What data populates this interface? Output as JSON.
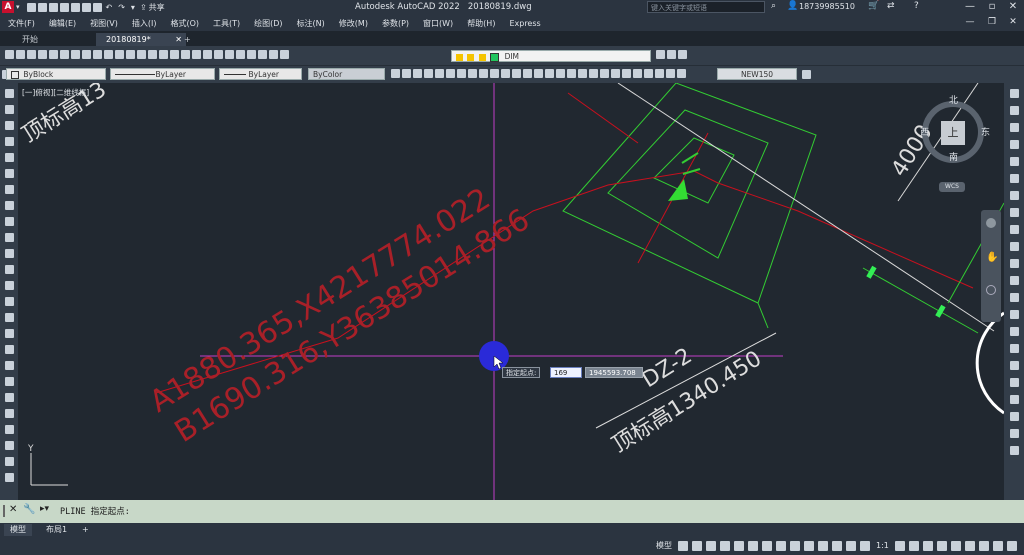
{
  "window": {
    "app_title": "Autodesk AutoCAD 2022",
    "file_title": "20180819.dwg",
    "share_label": "共享",
    "search_placeholder": "键入关键字或短语",
    "user": "18739985510",
    "min": "—",
    "max": "▫",
    "close": "✕"
  },
  "menu": [
    "文件(F)",
    "编辑(E)",
    "视图(V)",
    "插入(I)",
    "格式(O)",
    "工具(T)",
    "绘图(D)",
    "标注(N)",
    "修改(M)",
    "参数(P)",
    "窗口(W)",
    "帮助(H)",
    "Express"
  ],
  "tabs": [
    {
      "label": "开始"
    },
    {
      "label": "20180819*"
    },
    {
      "label": "+"
    }
  ],
  "toolbar": {
    "layer_name": "DIM",
    "block": "ByBlock",
    "linetype": "ByLayer",
    "lineweight": "ByLayer",
    "color": "ByColor",
    "dimstyle": "NEW150"
  },
  "viewport": {
    "label": "[一]俯视][二维线框]",
    "compass": {
      "north": "北",
      "south": "南",
      "east": "东",
      "west": "西",
      "top": "上",
      "wcs": "WCS"
    },
    "annotations": {
      "top_left": "顶标高13",
      "coord_a": "A1880.365,X4217774.022",
      "coord_b": "B1690.316,Y36385014.866",
      "dz": "DZ-2",
      "elev": "顶标高1340.450",
      "dist": "4000"
    },
    "ucs_y": "Y",
    "dynamic_input": {
      "prompt": "指定起点:",
      "x_value": "169",
      "y_value": "1945593.708"
    }
  },
  "command": {
    "text": "PLINE 指定起点:"
  },
  "layout_tabs": [
    {
      "label": "模型"
    },
    {
      "label": "布局1"
    },
    {
      "label": "+"
    }
  ],
  "status": {
    "model": "模型",
    "scale": "1:1"
  }
}
